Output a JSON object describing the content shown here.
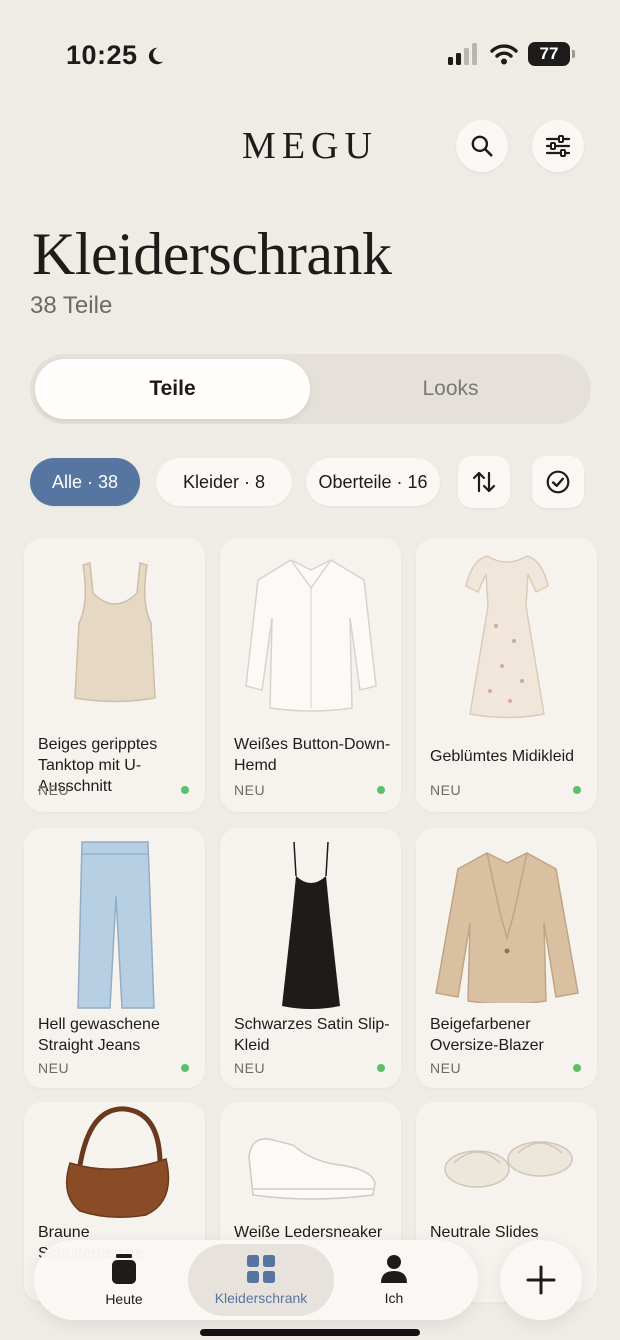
{
  "status": {
    "time": "10:25",
    "battery": "77"
  },
  "header": {
    "brand": "MEGU"
  },
  "page": {
    "title": "Kleiderschrank",
    "count": "38 Teile"
  },
  "segments": {
    "active": "Teile",
    "inactive": "Looks"
  },
  "chips": [
    {
      "label": "Alle · 38",
      "active": true
    },
    {
      "label": "Kleider  ·  8",
      "active": false
    },
    {
      "label": "Oberteile · 16",
      "active": false
    }
  ],
  "items": [
    {
      "name": "Beiges geripptes Tanktop mit U-Ausschnitt",
      "tag": "NEU",
      "icon": "tank-top-icon"
    },
    {
      "name": "Weißes Button-Down-Hemd",
      "tag": "NEU",
      "icon": "shirt-icon"
    },
    {
      "name": "Geblümtes Midikleid",
      "tag": "NEU",
      "icon": "dress-icon"
    },
    {
      "name": "Hell gewaschene Straight Jeans",
      "tag": "NEU",
      "icon": "jeans-icon"
    },
    {
      "name": "Schwarzes Satin Slip-Kleid",
      "tag": "NEU",
      "icon": "slip-dress-icon"
    },
    {
      "name": "Beigefarbener Oversize-Blazer",
      "tag": "NEU",
      "icon": "blazer-icon"
    },
    {
      "name": "Braune Schultertasche",
      "tag": "",
      "icon": "shoulder-bag-icon"
    },
    {
      "name": "Weiße Ledersneaker",
      "tag": "",
      "icon": "sneaker-icon"
    },
    {
      "name": "Neutrale Slides",
      "tag": "",
      "icon": "slides-icon"
    }
  ],
  "nav": {
    "today": "Heute",
    "wardrobe": "Kleiderschrank",
    "me": "Ich"
  },
  "colors": {
    "accent": "#5676A1",
    "background": "#EFEBE5",
    "new_dot": "#5CBF6A"
  }
}
